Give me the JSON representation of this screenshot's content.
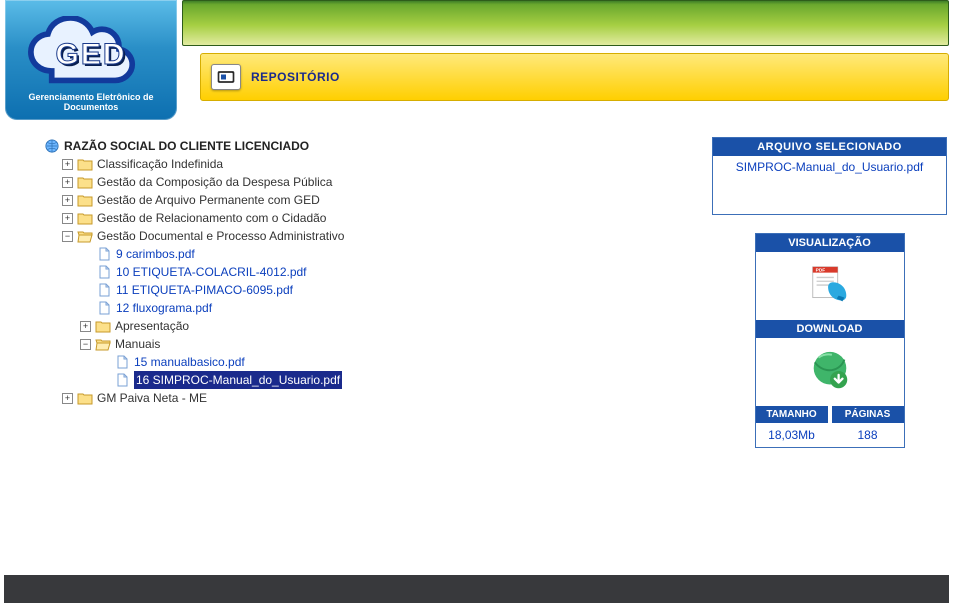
{
  "brand": {
    "acronym": "GED",
    "subtitle": "Gerenciamento Eletrônico de Documentos"
  },
  "banner": {
    "repo_label": "REPOSITÓRIO"
  },
  "tree": {
    "root": "RAZÃO SOCIAL DO CLIENTE LICENCIADO",
    "folders": [
      {
        "label": "Classificação Indefinida"
      },
      {
        "label": "Gestão da Composição da Despesa Pública"
      },
      {
        "label": "Gestão de Arquivo Permanente com GED"
      },
      {
        "label": "Gestão de Relacionamento com o Cidadão"
      },
      {
        "label": "Gestão Documental e Processo Administrativo",
        "open": true,
        "files": [
          {
            "label": "9 carimbos.pdf"
          },
          {
            "label": "10 ETIQUETA-COLACRIL-4012.pdf"
          },
          {
            "label": "11 ETIQUETA-PIMACO-6095.pdf"
          },
          {
            "label": "12 fluxograma.pdf"
          }
        ],
        "subfolders": [
          {
            "label": "Apresentação"
          },
          {
            "label": "Manuais",
            "open": true,
            "files": [
              {
                "label": "15 manualbasico.pdf"
              },
              {
                "label": "16 SIMPROC-Manual_do_Usuario.pdf",
                "selected": true
              }
            ]
          }
        ]
      },
      {
        "label": "GM Paiva Neta - ME"
      }
    ]
  },
  "side": {
    "selected_header": "ARQUIVO SELECIONADO",
    "selected_file": "SIMPROC-Manual_do_Usuario.pdf",
    "preview_header": "VISUALIZAÇÃO",
    "download_header": "DOWNLOAD",
    "size_header": "TAMANHO",
    "pages_header": "PÁGINAS",
    "size_value": "18,03Mb",
    "pages_value": "188"
  }
}
